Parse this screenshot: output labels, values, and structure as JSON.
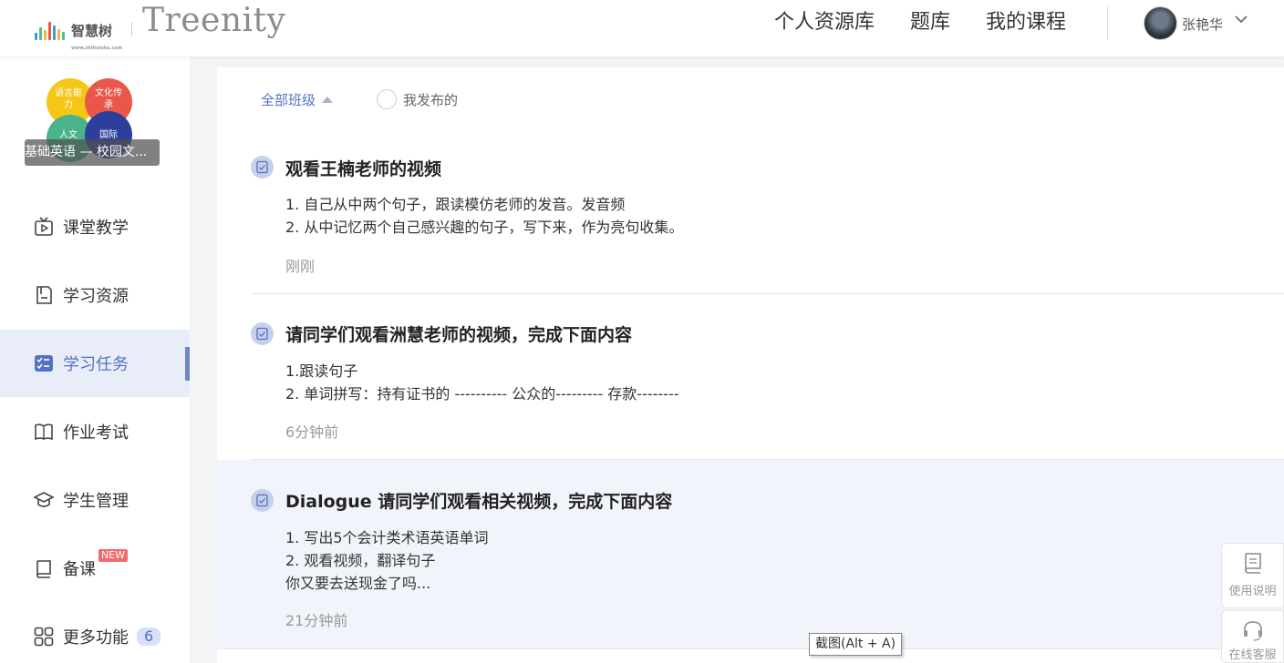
{
  "header": {
    "logo_text": "智慧树",
    "logo_sub": "www.zhihuishu.com",
    "brand": "Treenity",
    "nav": [
      "个人资源库",
      "题库",
      "我的课程"
    ],
    "user_name": "张艳华"
  },
  "sidebar": {
    "course": {
      "name": "基础英语 — 校园文...",
      "bubbles": [
        "语言能力",
        "文化传承",
        "人文",
        "国际"
      ]
    },
    "items": [
      {
        "label": "课堂教学",
        "icon": "video-play-icon"
      },
      {
        "label": "学习资源",
        "icon": "document-icon"
      },
      {
        "label": "学习任务",
        "icon": "task-list-icon",
        "active": true
      },
      {
        "label": "作业考试",
        "icon": "open-book-icon"
      },
      {
        "label": "学生管理",
        "icon": "graduation-cap-icon"
      },
      {
        "label": "备课",
        "icon": "book-icon",
        "badge": "NEW"
      },
      {
        "label": "更多功能",
        "icon": "grid-icon",
        "count": "6"
      }
    ]
  },
  "filters": {
    "all_classes": "全部班级",
    "mine": "我发布的"
  },
  "tasks": [
    {
      "title": "观看王楠老师的视频",
      "lines": [
        "1. 自己从中两个句子，跟读模仿老师的发音。发音频",
        "2. 从中记忆两个自己感兴趣的句子，写下来，作为亮句收集。"
      ],
      "time": "刚刚"
    },
    {
      "title": "请同学们观看洲慧老师的视频，完成下面内容",
      "lines": [
        "1.跟读句子",
        "2. 单词拼写：持有证书的 ---------- 公众的--------- 存款--------"
      ],
      "time": "6分钟前"
    },
    {
      "title": "Dialogue 请同学们观看相关视频，完成下面内容",
      "lines": [
        "1. 写出5个会计类术语英语单词",
        "2. 观看视频，翻译句子",
        "你又要去送现金了吗..."
      ],
      "time": "21分钟前"
    }
  ],
  "widgets": {
    "manual": "使用说明",
    "service": "在线客服"
  },
  "tooltip": "截图(Alt + A)",
  "colors": {
    "accent": "#5471c4",
    "active_bg": "#e9edf7",
    "badge_new": "#f26a6a"
  }
}
